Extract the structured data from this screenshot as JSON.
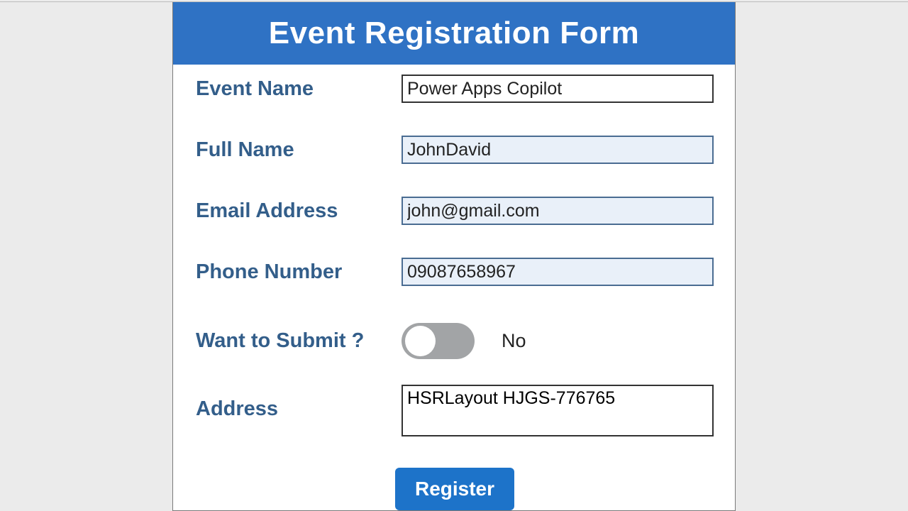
{
  "header": {
    "title": "Event Registration Form"
  },
  "fields": {
    "event_name": {
      "label": "Event Name",
      "value": "Power Apps Copilot"
    },
    "full_name": {
      "label": "Full Name",
      "value": "JohnDavid"
    },
    "email": {
      "label": "Email Address",
      "value": "john@gmail.com"
    },
    "phone": {
      "label": "Phone Number",
      "value": "09087658967"
    },
    "submit_toggle": {
      "label": "Want to Submit ?",
      "value_text": "No"
    },
    "address": {
      "label": "Address",
      "value": "HSRLayout HJGS-776765"
    }
  },
  "actions": {
    "register": "Register"
  }
}
